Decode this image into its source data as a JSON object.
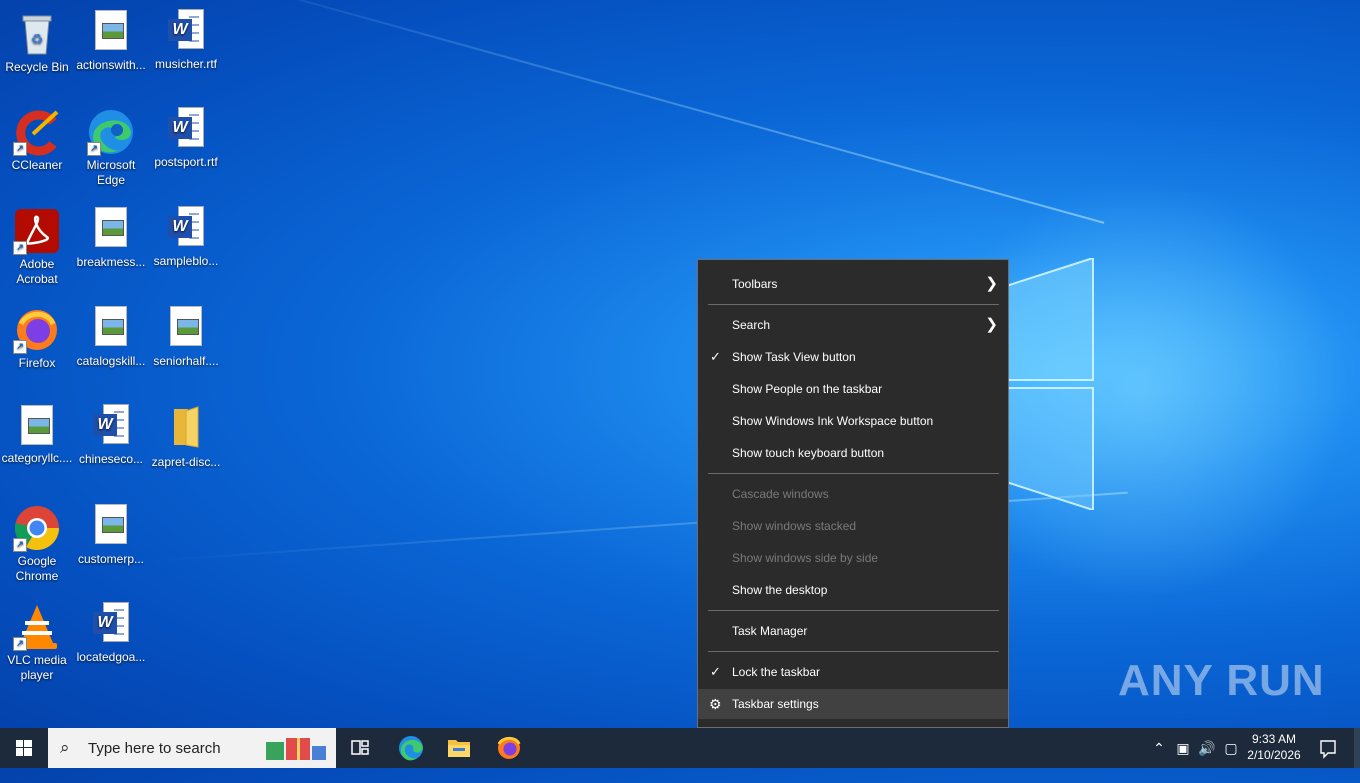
{
  "desktop": {
    "icons": [
      {
        "label": "Recycle Bin",
        "icon": "recycle-bin-icon"
      },
      {
        "label": "actionswith...",
        "icon": "image-file-icon"
      },
      {
        "label": "musicher.rtf",
        "icon": "word-document-icon"
      },
      {
        "label": "CCleaner",
        "icon": "ccleaner-icon"
      },
      {
        "label": "Microsoft Edge",
        "icon": "edge-icon"
      },
      {
        "label": "postsport.rtf",
        "icon": "word-document-icon"
      },
      {
        "label": "Adobe Acrobat",
        "icon": "acrobat-icon"
      },
      {
        "label": "breakmess...",
        "icon": "image-file-icon"
      },
      {
        "label": "sampleblo...",
        "icon": "word-document-icon"
      },
      {
        "label": "Firefox",
        "icon": "firefox-icon"
      },
      {
        "label": "catalogskill...",
        "icon": "image-file-icon"
      },
      {
        "label": "seniorhalf....",
        "icon": "image-file-icon"
      },
      {
        "label": "categoryllc....",
        "icon": "image-file-icon"
      },
      {
        "label": "chineseco...",
        "icon": "word-document-icon"
      },
      {
        "label": "zapret-disc...",
        "icon": "folder-icon"
      },
      {
        "label": "Google Chrome",
        "icon": "chrome-icon"
      },
      {
        "label": "customerp...",
        "icon": "image-file-icon"
      },
      {
        "label": "VLC media player",
        "icon": "vlc-icon"
      },
      {
        "label": "locatedgoa...",
        "icon": "word-document-icon"
      }
    ]
  },
  "context_menu": {
    "items": [
      {
        "label": "Toolbars",
        "submenu": true
      },
      {
        "label": "Search",
        "submenu": true
      },
      {
        "label": "Show Task View button",
        "checked": true
      },
      {
        "label": "Show People on the taskbar"
      },
      {
        "label": "Show Windows Ink Workspace button"
      },
      {
        "label": "Show touch keyboard button"
      },
      {
        "label": "Cascade windows",
        "disabled": true
      },
      {
        "label": "Show windows stacked",
        "disabled": true
      },
      {
        "label": "Show windows side by side",
        "disabled": true
      },
      {
        "label": "Show the desktop"
      },
      {
        "label": "Task Manager"
      },
      {
        "label": "Lock the taskbar",
        "checked": true
      },
      {
        "label": "Taskbar settings",
        "highlighted": true
      }
    ]
  },
  "taskbar": {
    "search_placeholder": "Type here to search",
    "pinned": [
      "task-view-icon",
      "edge-icon",
      "file-explorer-icon",
      "firefox-icon"
    ],
    "clock": {
      "time": "9:33 AM",
      "date": "2/10/2026"
    }
  },
  "watermark": {
    "text": "ANY RUN"
  },
  "colors": {
    "menu_bg": "#2b2b2b",
    "menu_highlight": "#414141",
    "taskbar_bg": "#1c2a3b",
    "desktop_blue": "#0b67d6"
  }
}
